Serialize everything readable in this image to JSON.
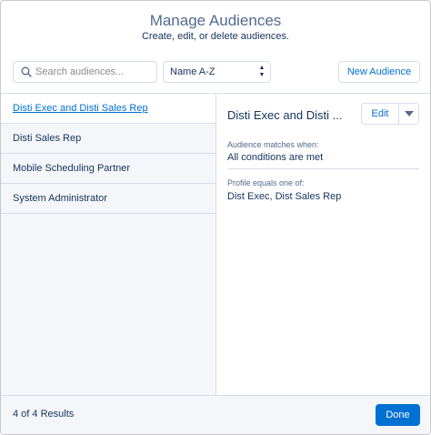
{
  "header": {
    "title": "Manage Audiences",
    "subtitle": "Create, edit, or delete audiences."
  },
  "toolbar": {
    "search_placeholder": "Search audiences...",
    "search_value": "",
    "sort_value": "Name A-Z",
    "new_button": "New Audience"
  },
  "list": {
    "items": [
      {
        "label": "Disti Exec and Disti Sales Rep",
        "selected": true
      },
      {
        "label": "Disti Sales Rep",
        "selected": false
      },
      {
        "label": "Mobile Scheduling Partner",
        "selected": false
      },
      {
        "label": "System Administrator",
        "selected": false
      }
    ]
  },
  "detail": {
    "title": "Disti Exec and Disti ...",
    "edit_button": "Edit",
    "match_label": "Audience matches when:",
    "match_value": "All conditions are met",
    "criterion_label": "Profile equals one of:",
    "criterion_value": "Dist Exec, Dist Sales Rep"
  },
  "footer": {
    "results": "4 of 4 Results",
    "done_button": "Done"
  },
  "colors": {
    "accent": "#0070d2",
    "text": "#16325c",
    "muted": "#54698d",
    "border": "#d8dde6",
    "list_bg": "#f4f6f9"
  },
  "icons": {
    "search": "search-icon",
    "sort": "sort-arrows-icon",
    "menu": "chevron-down-icon"
  }
}
